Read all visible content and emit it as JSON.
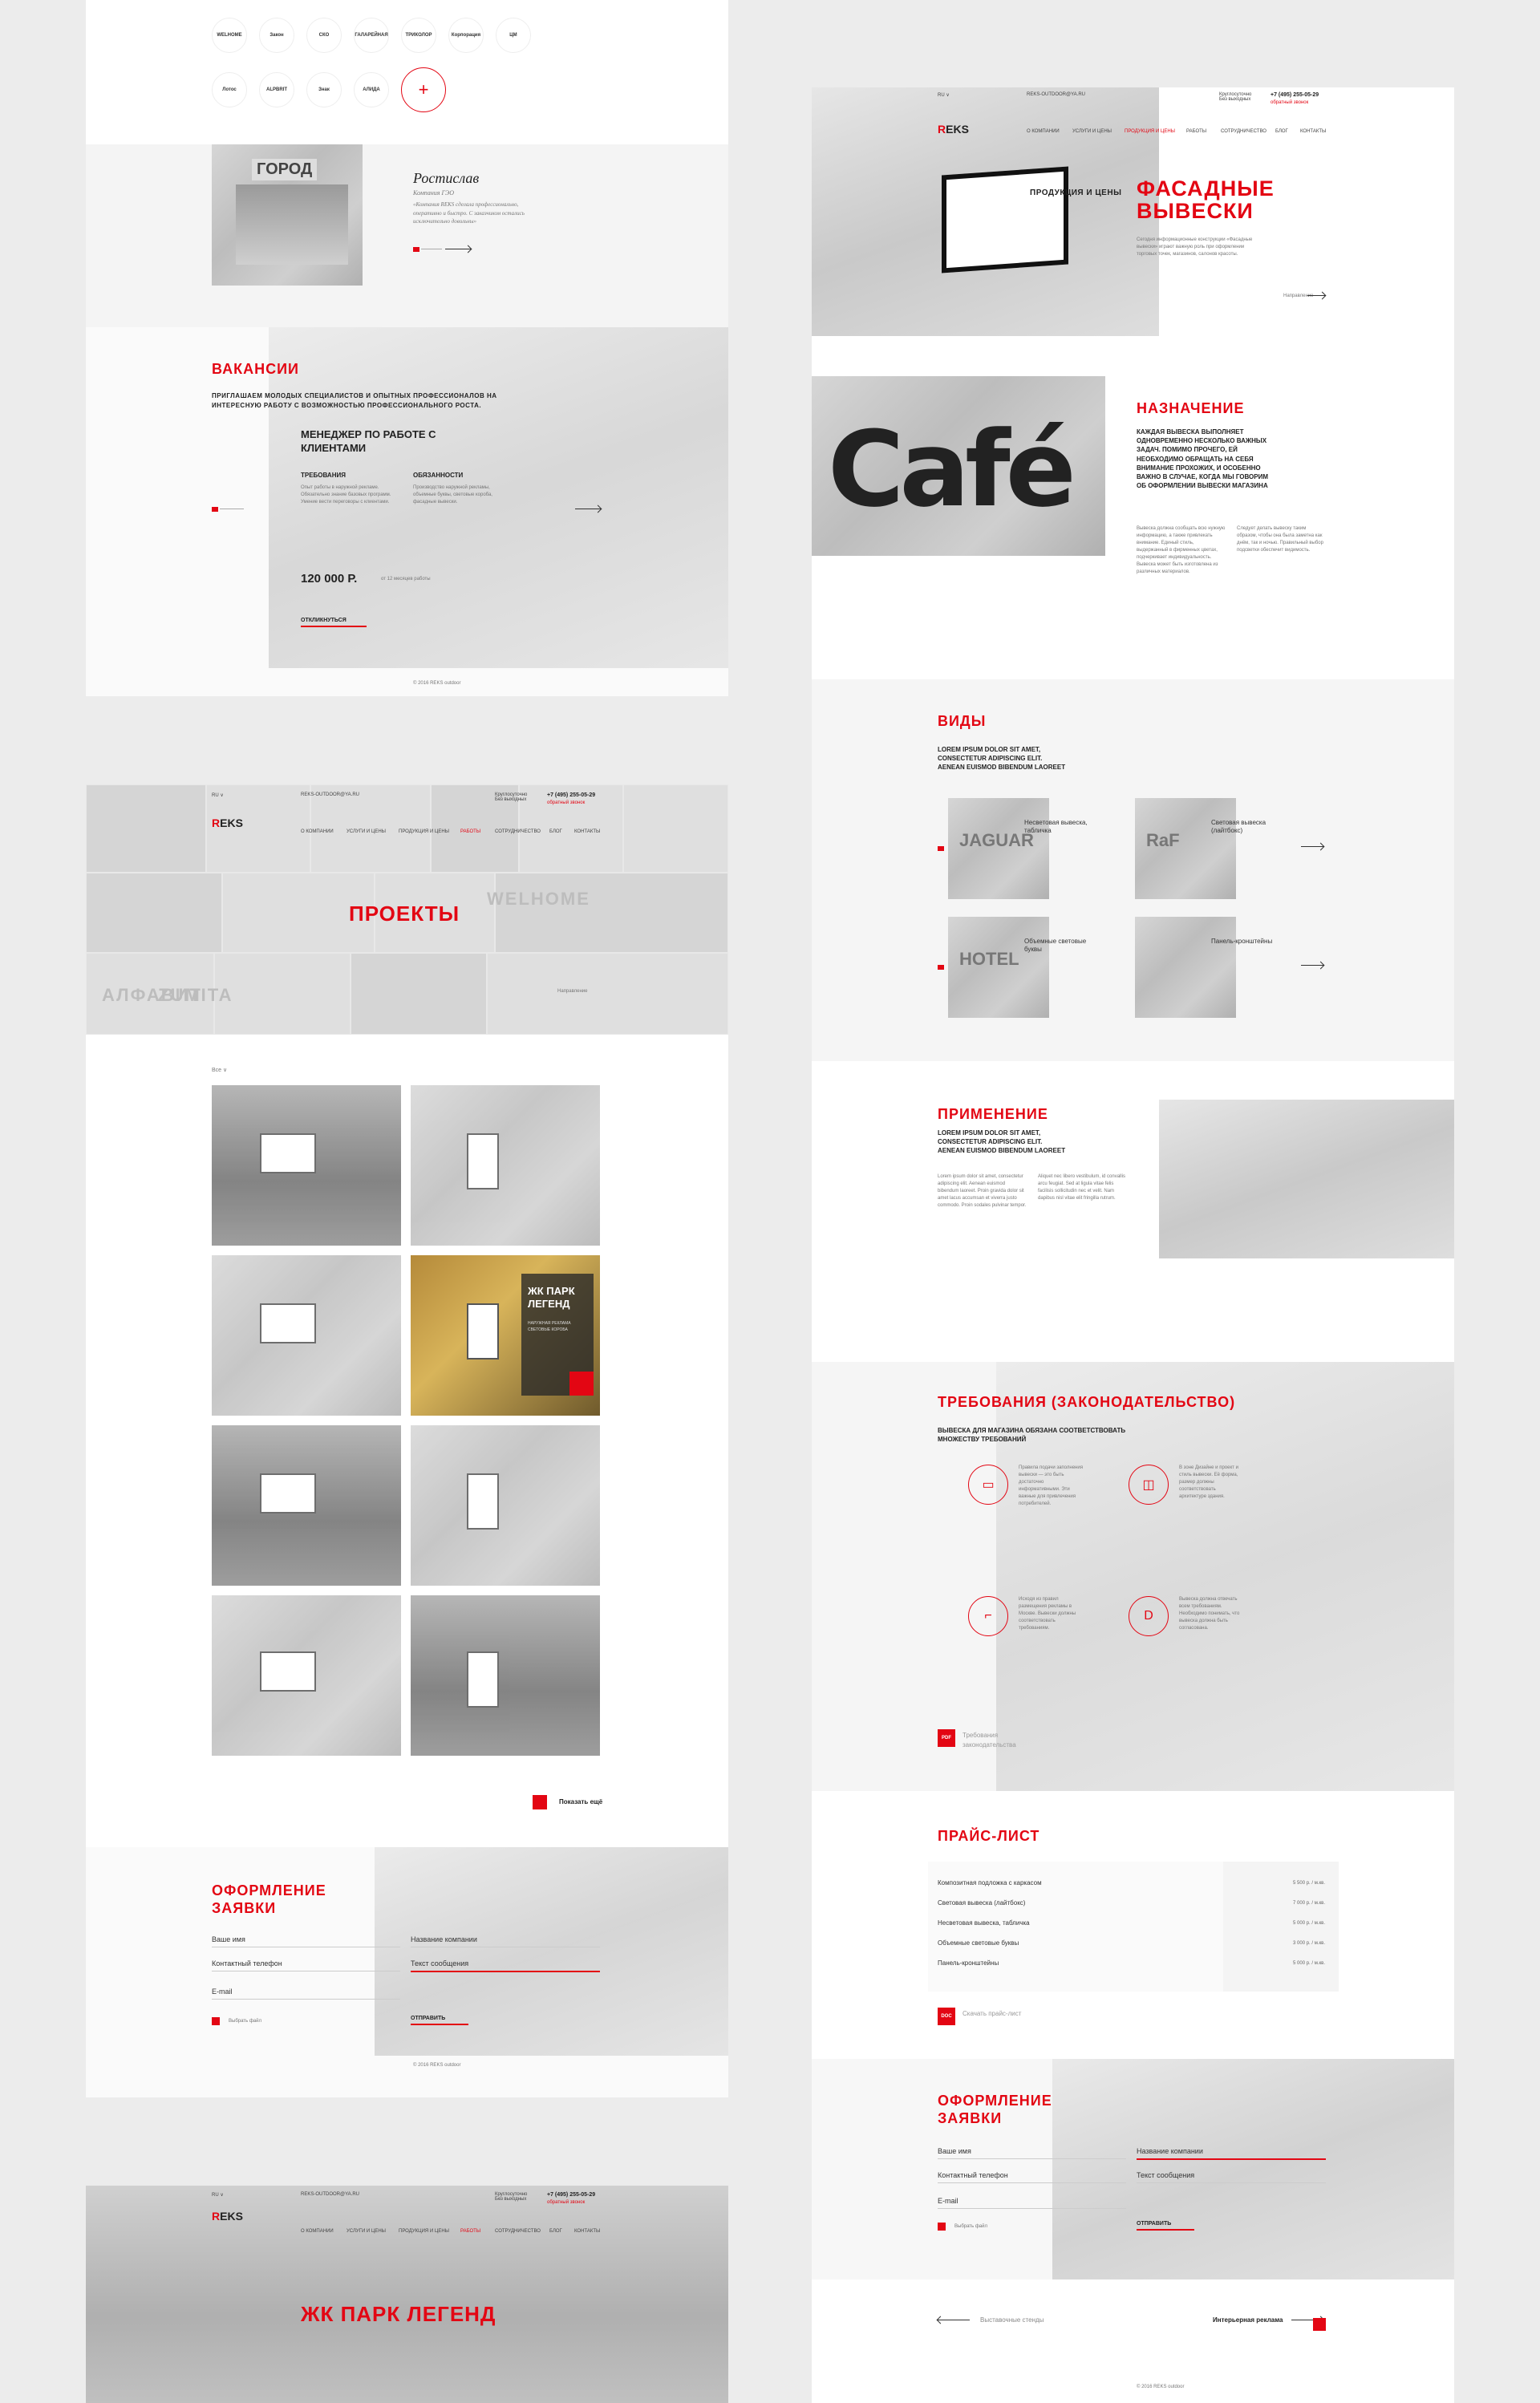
{
  "left_top": {
    "partner_logos": [
      "WELHOME",
      "Закон",
      "СКО",
      "ГАЛАРЕЙНАЯ",
      "ТРИКОЛОР",
      "Корпорация",
      "ЦМ",
      "Лотос",
      "ALPBRIT",
      "Знак",
      "АЛИДА",
      "+"
    ],
    "testimonial": {
      "name": "Ростислав",
      "company": "Компания ГЭО",
      "text": "«Компания REKS сделала профессионально, оперативно и быстро. С заказчиком остались исключительно довольны»",
      "photo_sign": "ГОРОД"
    },
    "vacancies": {
      "title": "ВАКАНСИИ",
      "subtitle": "ПРИГЛАШАЕМ МОЛОДЫХ СПЕЦИАЛИСТОВ И ОПЫТНЫХ ПРОФЕССИОНАЛОВ НА ИНТЕРЕСНУЮ РАБОТУ С ВОЗМОЖНОСТЬЮ ПРОФЕССИОНАЛЬНОГО РОСТА.",
      "job_title": "МЕНЕДЖЕР ПО РАБОТЕ С КЛИЕНТАМИ",
      "req_label": "ТРЕБОВАНИЯ",
      "duty_label": "ОБЯЗАННОСТИ",
      "req_text": "Опыт работы в наружной рекламе. Обязательно знание базовых программ. Умение вести переговоры с клиентами.",
      "duty_text": "Производство наружной рекламы, объемные буквы, световые короба, фасадные вывески.",
      "salary": "120 000 Р.",
      "salary_note": "от 12 месяцев работы",
      "cta": "ОТКЛИКНУТЬСЯ"
    },
    "copyright": "© 2016 REKS outdoor"
  },
  "nav": {
    "lang": "RU ∨",
    "site": "REKS-OUTDOOR@YA.RU",
    "hours": "Круглосуточно\nБез выходных",
    "phone": "+7 (495) 255-05-29",
    "callback": "обратный звонок",
    "items": [
      "О КОМПАНИИ",
      "УСЛУГИ И ЦЕНЫ",
      "ПРОДУКЦИЯ И ЦЕНЫ",
      "РАБОТЫ",
      "СОТРУДНИЧЕСТВО",
      "БЛОГ",
      "КОНТАКТЫ"
    ]
  },
  "projects": {
    "title": "ПРОЕКТЫ",
    "filter": "Все ∨",
    "next_label": "Направление",
    "card_title": "ЖК ПАРК ЛЕГЕНД",
    "card_tags": "НАРУЖНАЯ РЕКЛАМА\nСВЕТОВЫЕ КОРОБА",
    "show_more": "Показать ещё",
    "brand_words": [
      "WELHOME",
      "ZUMITA",
      "АЛФАВИТ"
    ]
  },
  "form_left": {
    "title": "ОФОРМЛЕНИЕ ЗАЯВКИ",
    "name": "Ваше имя",
    "phone": "Контактный телефон",
    "email": "E-mail",
    "company": "Название компании",
    "message": "Текст сообщения",
    "attach": "Выбрать файл",
    "submit": "ОТПРАВИТЬ",
    "copyright": "© 2016 REKS outdoor"
  },
  "park": {
    "title": "ЖК ПАРК ЛЕГЕНД"
  },
  "right": {
    "hero": {
      "breadcrumb": "ПРОДУКЦИЯ И ЦЕНЫ",
      "title": "ФАСАДНЫЕ ВЫВЕСКИ",
      "text": "Сегодня информационные конструкции «Фасадные вывески» играют важную роль при оформлении торговых точек, магазинов, салонов красоты.",
      "link": "Направление"
    },
    "purpose": {
      "title": "НАЗНАЧЕНИЕ",
      "lead": "КАЖДАЯ ВЫВЕСКА ВЫПОЛНЯЕТ ОДНОВРЕМЕННО НЕСКОЛЬКО ВАЖНЫХ ЗАДАЧ. ПОМИМО ПРОЧЕГО, ЕЙ НЕОБХОДИМО ОБРАЩАТЬ НА СЕБЯ ВНИМАНИЕ ПРОХОЖИХ, И ОСОБЕННО ВАЖНО В СЛУЧАЕ, КОГДА МЫ ГОВОРИМ ОБ ОФОРМЛЕНИИ ВЫВЕСКИ МАГАЗИНА",
      "col1": "Вывеска должна сообщать всю нужную информацию, а также привлекать внимание. Единый стиль, выдержанный в фирменных цветах, подчеркивает индивидуальность. Вывеска может быть изготовлена из различных материалов.",
      "col2": "Следует делать вывеску таким образом, чтобы она была заметна как днём, так и ночью. Правильный выбор подсветки обеспечит видимость.",
      "photo_word": "Café"
    },
    "kinds": {
      "title": "ВИДЫ",
      "subtitle": "LOREM IPSUM DOLOR SIT AMET, CONSECTETUR ADIPISCING ELIT. AENEAN EUISMOD BIBENDUM LAOREET",
      "items": [
        "Несветовая вывеска, табличка",
        "Световая вывеска (лайтбокс)",
        "Объемные световые буквы",
        "Панель-кронштейны"
      ],
      "thumb_words": [
        "JAGUAR",
        "RaF",
        "HOTEL",
        ""
      ]
    },
    "apply": {
      "title": "ПРИМЕНЕНИЕ",
      "subtitle": "LOREM IPSUM DOLOR SIT AMET, CONSECTETUR ADIPISCING ELIT. AENEAN EUISMOD BIBENDUM LAOREET",
      "col1": "Lorem ipsum dolor sit amet, consectetur adipiscing elit. Aenean euismod bibendum laoreet. Proin gravida dolor sit amet lacus accumsan et viverra justo commodo. Proin sodales pulvinar tempor.",
      "col2": "Aliquet nec libero vestibulum, id convallis arcu feugiat. Sed at ligula vitae felis facilisis sollicitudin nec et velit. Nam dapibus nisl vitae elit fringilla rutrum."
    },
    "law": {
      "title": "ТРЕБОВАНИЯ (ЗАКОНОДАТЕЛЬСТВО)",
      "subtitle": "ВЫВЕСКА ДЛЯ МАГАЗИНА ОБЯЗАНА СООТВЕТСТВОВАТЬ МНОЖЕСТВУ ТРЕБОВАНИЙ",
      "items": [
        "Правила подачи заполнения вывески — это быть достаточно информативными. Эти важные для привлечения потребителей.",
        "В зоне Дизайне и проект и стиль вывески. Её форма, размер должны соответствовать архитектуре здания.",
        "Исходя из правил размещения рекламы в Москве. Вывески должны соответствовать требованиям.",
        "Вывеска должна отвечать всем требованиям. Необходимо понимать, что вывеска должна быть согласована."
      ],
      "pdf": "PDF",
      "pdf_label": "Требования законодательства"
    },
    "price": {
      "title": "ПРАЙС-ЛИСТ",
      "rows": [
        {
          "name": "Композитная подложка с каркасом",
          "price": "5 500 р. / м.кв."
        },
        {
          "name": "Световая вывеска (лайтбокс)",
          "price": "7 000 р. / м.кв."
        },
        {
          "name": "Несветовая вывеска, табличка",
          "price": "5 000 р. / м.кв."
        },
        {
          "name": "Объемные световые буквы",
          "price": "3 000 р. / м.кв."
        },
        {
          "name": "Панель-кронштейны",
          "price": "5 000 р. / м.кв."
        }
      ],
      "doc": "DOC",
      "doc_label": "Скачать прайс-лист"
    },
    "form": {
      "title": "ОФОРМЛЕНИЕ ЗАЯВКИ",
      "name": "Ваше имя",
      "phone": "Контактный телефон",
      "email": "E-mail",
      "company": "Название компании",
      "message": "Текст сообщения",
      "attach": "Выбрать файл",
      "submit": "ОТПРАВИТЬ"
    },
    "footer": {
      "prev": "Выставочные стенды",
      "next": "Интерьерная реклама",
      "copyright": "© 2016 REKS outdoor"
    }
  },
  "colors": {
    "accent": "#e30613",
    "bg": "#ececec"
  }
}
